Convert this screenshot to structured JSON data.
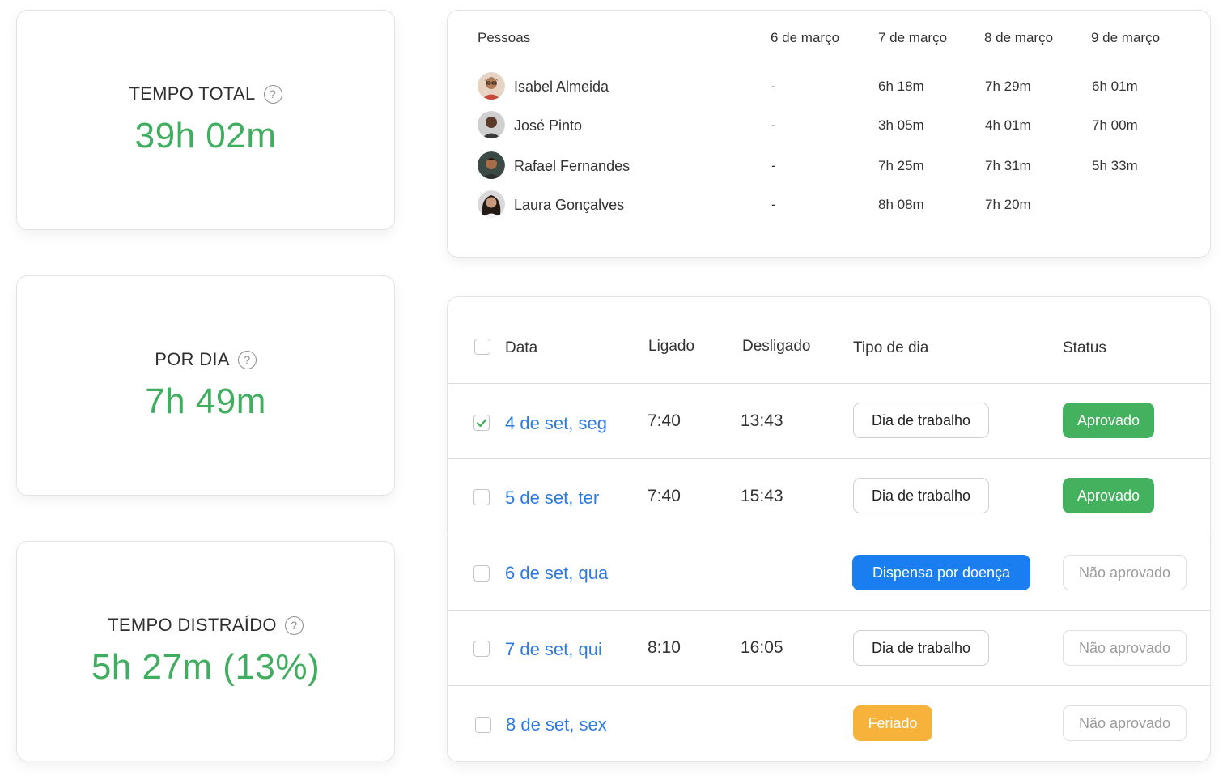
{
  "stats": {
    "total": {
      "label": "TEMPO TOTAL",
      "value": "39h 02m"
    },
    "per_day": {
      "label": "POR DIA",
      "value": "7h 49m"
    },
    "distracted": {
      "label": "TEMPO DISTRAÍDO",
      "value": "5h 27m (13%)"
    },
    "help_glyph": "?"
  },
  "people_table": {
    "headers": [
      "Pessoas",
      "6 de março",
      "7 de março",
      "8 de março",
      "9 de março"
    ],
    "rows": [
      {
        "name": "Isabel Almeida",
        "values": [
          "-",
          "6h 18m",
          "7h 29m",
          "6h 01m"
        ]
      },
      {
        "name": "José Pinto",
        "values": [
          "-",
          "3h 05m",
          "4h 01m",
          "7h 00m"
        ]
      },
      {
        "name": "Rafael Fernandes",
        "values": [
          "-",
          "7h 25m",
          "7h 31m",
          "5h 33m"
        ]
      },
      {
        "name": "Laura Gonçalves",
        "values": [
          "-",
          "8h 08m",
          "7h 20m",
          ""
        ]
      }
    ]
  },
  "timesheet": {
    "headers": {
      "date": "Data",
      "on": "Ligado",
      "off": "Desligado",
      "day_type": "Tipo de dia",
      "status": "Status"
    },
    "rows": [
      {
        "checked": true,
        "date": "4 de set, seg",
        "on": "7:40",
        "off": "13:43",
        "day_type": "Dia de trabalho",
        "day_type_style": "outline",
        "status": "Aprovado",
        "status_style": "green"
      },
      {
        "checked": false,
        "date": "5 de set, ter",
        "on": "7:40",
        "off": "15:43",
        "day_type": "Dia de trabalho",
        "day_type_style": "outline",
        "status": "Aprovado",
        "status_style": "green"
      },
      {
        "checked": false,
        "date": "6 de set, qua",
        "on": "",
        "off": "",
        "day_type": "Dispensa por doença",
        "day_type_style": "blue",
        "status": "Não aprovado",
        "status_style": "muted"
      },
      {
        "checked": false,
        "date": "7 de set, qui",
        "on": "8:10",
        "off": "16:05",
        "day_type": "Dia de trabalho",
        "day_type_style": "outline",
        "status": "Não aprovado",
        "status_style": "muted"
      },
      {
        "checked": false,
        "date": "8 de set, sex",
        "on": "",
        "off": "",
        "day_type": "Feriado",
        "day_type_style": "orange",
        "status": "Não aprovado",
        "status_style": "muted"
      }
    ]
  },
  "colors": {
    "accent_green": "#3fae5f",
    "link_blue": "#2b7be2",
    "sick_blue": "#1a7ef0",
    "holiday_orange": "#f6b23a"
  }
}
